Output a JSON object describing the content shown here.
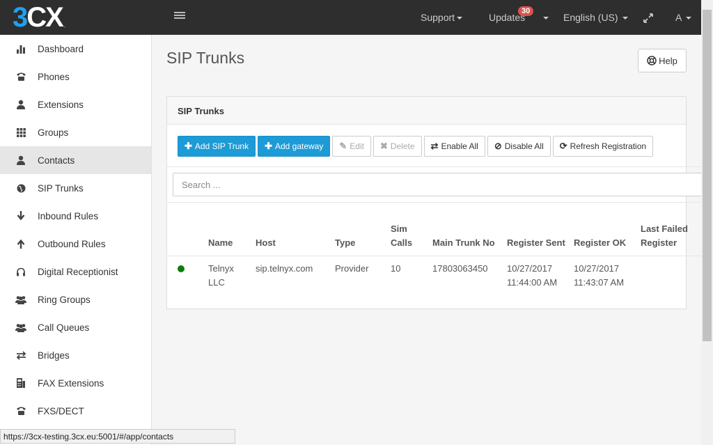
{
  "brand": {
    "logo_prefix": "3",
    "logo_suffix": "CX",
    "logo_dot": "."
  },
  "topnav": {
    "support": "Support",
    "updates": "Updates",
    "updates_badge": "30",
    "language": "English (US)",
    "user": "A"
  },
  "sidebar": {
    "items": [
      {
        "label": "Dashboard",
        "icon": "bar-chart-icon"
      },
      {
        "label": "Phones",
        "icon": "phone-icon"
      },
      {
        "label": "Extensions",
        "icon": "user-icon"
      },
      {
        "label": "Groups",
        "icon": "grid-icon"
      },
      {
        "label": "Contacts",
        "icon": "user-icon",
        "active": true
      },
      {
        "label": "SIP Trunks",
        "icon": "globe-icon"
      },
      {
        "label": "Inbound Rules",
        "icon": "arrow-down-icon"
      },
      {
        "label": "Outbound Rules",
        "icon": "arrow-up-icon"
      },
      {
        "label": "Digital Receptionist",
        "icon": "headphones-icon"
      },
      {
        "label": "Ring Groups",
        "icon": "users-icon"
      },
      {
        "label": "Call Queues",
        "icon": "users-icon"
      },
      {
        "label": "Bridges",
        "icon": "exchange-icon"
      },
      {
        "label": "FAX Extensions",
        "icon": "fax-icon"
      },
      {
        "label": "FXS/DECT",
        "icon": "phone-icon"
      }
    ]
  },
  "page": {
    "title": "SIP Trunks",
    "help_label": "Help",
    "panel_title": "SIP Trunks",
    "toolbar": {
      "add_trunk": "Add SIP Trunk",
      "add_gateway": "Add gateway",
      "edit": "Edit",
      "delete": "Delete",
      "enable_all": "Enable All",
      "disable_all": "Disable All",
      "refresh": "Refresh Registration"
    },
    "search_placeholder": "Search ...",
    "table": {
      "headers": [
        "",
        "Name",
        "Host",
        "Type",
        "Sim Calls",
        "Main Trunk No",
        "Register Sent",
        "Register OK",
        "Last Failed Register"
      ],
      "rows": [
        {
          "status": "registered",
          "name": "Telnyx LLC",
          "host": "sip.telnyx.com",
          "type": "Provider",
          "sim_calls": "10",
          "main_trunk_no": "17803063450",
          "register_sent": "10/27/2017 11:44:00 AM",
          "register_ok": "10/27/2017 11:43:07 AM",
          "last_failed": ""
        }
      ]
    }
  },
  "status_bar": {
    "url": "https://3cx-testing.3cx.eu:5001/#/app/contacts"
  },
  "colors": {
    "topbar": "#2e2e2e",
    "primary_button": "#1c9bd6",
    "status_ok": "#0a7e07",
    "badge": "#d9534f"
  }
}
